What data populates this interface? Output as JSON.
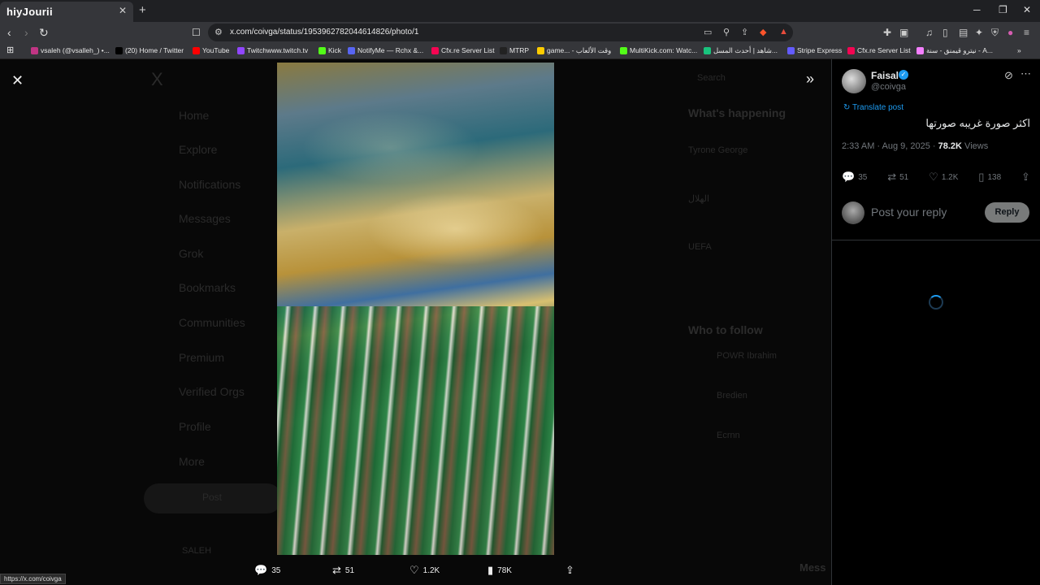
{
  "browser": {
    "tab_title": "hiyJourii",
    "url": "x.com/coivga/status/1953962782044614826/photo/1",
    "status_url": "https://x.com/coivga"
  },
  "bookmarks": [
    {
      "label": "vsaleh (@vsalleh_) •...",
      "color": "#c13584"
    },
    {
      "label": "(20) Home / Twitter",
      "color": "#000000"
    },
    {
      "label": "YouTube",
      "color": "#ff0000"
    },
    {
      "label": "Twitchwww.twitch.tv",
      "color": "#9146ff"
    },
    {
      "label": "Kick",
      "color": "#53fc18"
    },
    {
      "label": "NotifyMe — Rchx &...",
      "color": "#5865f2"
    },
    {
      "label": "Cfx.re Server List",
      "color": "#f40552"
    },
    {
      "label": "MTRP",
      "color": "#222222"
    },
    {
      "label": "game... - وقت الألعاب",
      "color": "#ffcc00"
    },
    {
      "label": "MultiKick.com: Watc...",
      "color": "#53fc18"
    },
    {
      "label": "شاهد | أحدث المسل...",
      "color": "#19c37d"
    },
    {
      "label": "Stripe Express",
      "color": "#635bff"
    },
    {
      "label": "Cfx.re Server List",
      "color": "#f40552"
    },
    {
      "label": "نيترو قيمنق - سنة - A...",
      "color": "#f47fff"
    }
  ],
  "background": {
    "nav": [
      "Home",
      "Explore",
      "Notifications",
      "Messages",
      "Grok",
      "Bookmarks",
      "Communities",
      "Premium",
      "Verified Orgs",
      "Profile",
      "More"
    ],
    "post_button": "Post",
    "account_name": "SALEH",
    "search": "Search",
    "whats_happening": "What's happening",
    "trends": [
      "Tyrone George",
      "الهلال",
      "UEFA"
    ],
    "who_to_follow": "Who to follow",
    "follow_suggestions": [
      "POWR Ibrahim",
      "Bredien",
      "Ecrnn"
    ],
    "messages": "Mess"
  },
  "media_bar": {
    "replies": "35",
    "reposts": "51",
    "likes": "1.2K",
    "views": "78K"
  },
  "tweet": {
    "name": "Faisal",
    "handle": "@coivga",
    "translate": "Translate post",
    "text": "اكثر صورة غريبه صورتها",
    "time": "2:33 AM · Aug 9, 2025 · ",
    "views_count": "78.2K",
    "views_label": " Views",
    "replies": "35",
    "reposts": "51",
    "likes": "1.2K",
    "bookmarks": "138",
    "reply_placeholder": "Post your reply",
    "reply_button": "Reply"
  }
}
